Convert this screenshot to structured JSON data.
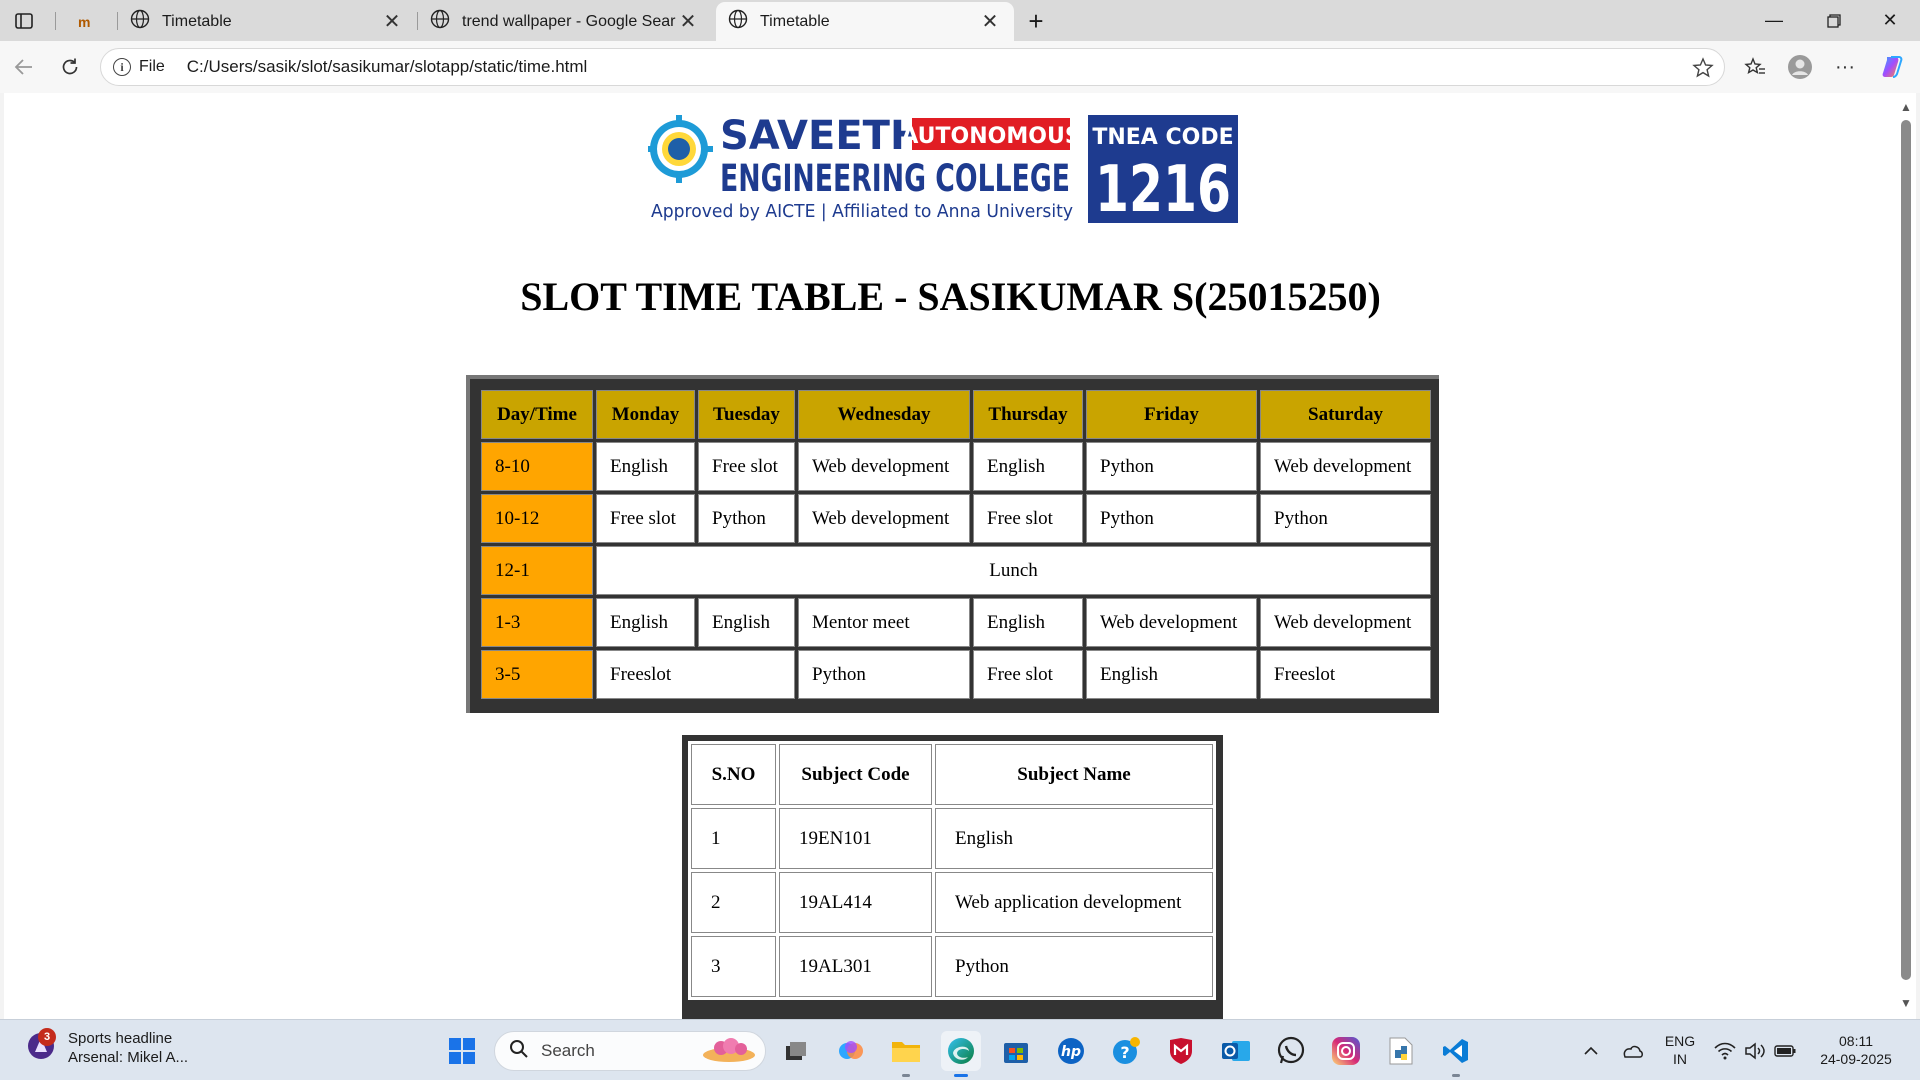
{
  "browser": {
    "tabs": [
      {
        "title": "",
        "active": false
      },
      {
        "title": "Timetable",
        "active": false
      },
      {
        "title": "trend wallpaper - Google Search",
        "active": false
      },
      {
        "title": "Timetable",
        "active": true
      }
    ],
    "address": {
      "scheme_label": "File",
      "url": "C:/Users/sasik/slot/sasikumar/slotapp/static/time.html"
    }
  },
  "page": {
    "logo": {
      "college_line1": "SAVEETHA",
      "college_line2": "ENGINEERING COLLEGE",
      "badge": "AUTONOMOUS",
      "tagline": "Approved by AICTE  |  Affiliated to Anna University",
      "tnea_label": "TNEA CODE",
      "tnea_code": "1216"
    },
    "heading": "SLOT TIME TABLE - SASIKUMAR S(25015250)",
    "timetable": {
      "headers": [
        "Day/Time",
        "Monday",
        "Tuesday",
        "Wednesday",
        "Thursday",
        "Friday",
        "Saturday"
      ],
      "rows": [
        {
          "time": "8-10",
          "cells": [
            "English",
            "Free slot",
            "Web development",
            "English",
            "Python",
            "Web development"
          ]
        },
        {
          "time": "10-12",
          "cells": [
            "Free slot",
            "Python",
            "Web development",
            "Free slot",
            "Python",
            "Python"
          ]
        },
        {
          "time": "12-1",
          "lunch": "Lunch"
        },
        {
          "time": "1-3",
          "cells": [
            "English",
            "English",
            "Mentor meet",
            "English",
            "Web development",
            "Web development"
          ]
        },
        {
          "time": "3-5",
          "mon_tue": "Freeslot",
          "cells": [
            "Python",
            "Free slot",
            "English",
            "Freeslot"
          ]
        }
      ]
    },
    "subjects": {
      "headers": [
        "S.NO",
        "Subject Code",
        "Subject Name"
      ],
      "rows": [
        [
          "1",
          "19EN101",
          "English"
        ],
        [
          "2",
          "19AL414",
          "Web application development"
        ],
        [
          "3",
          "19AL301",
          "Python"
        ]
      ]
    }
  },
  "taskbar": {
    "news": {
      "title": "Sports headline",
      "subtitle": "Arsenal: Mikel A...",
      "badge": "3"
    },
    "search_label": "Search",
    "lang": {
      "line1": "ENG",
      "line2": "IN"
    },
    "clock": {
      "time": "08:11",
      "date": "24-09-2025"
    },
    "pinned": [
      "task-view-icon",
      "copilot-icon",
      "file-explorer-icon",
      "edge-icon",
      "store-icon",
      "hp-icon",
      "help-icon",
      "mcafee-icon",
      "outlook-icon",
      "whatsapp-icon",
      "instagram-icon",
      "python-icon",
      "vscode-icon"
    ]
  }
}
